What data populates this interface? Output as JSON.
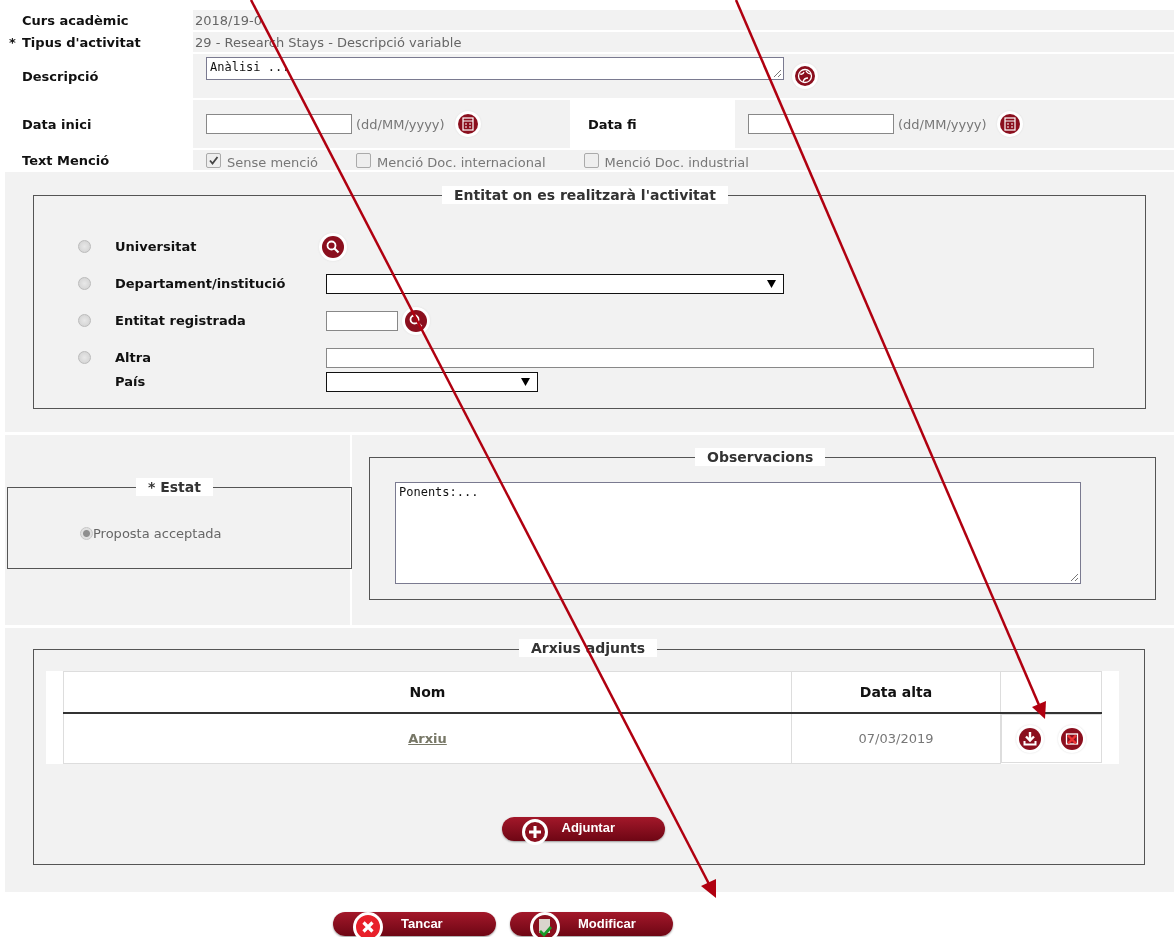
{
  "fields": [
    {
      "label": "Curs acadèmic",
      "value": "2018/19-0"
    },
    {
      "label": "Tipus d'activitat",
      "required_mark": "*",
      "value": "29 - Research Stays - Descripció variable"
    }
  ],
  "description": {
    "label": "Descripció",
    "value": "Anàlisi ..."
  },
  "dates": [
    {
      "label": "Data inici",
      "format": "(dd/MM/yyyy)"
    },
    {
      "label": "Data fi",
      "format": "(dd/MM/yyyy)"
    }
  ],
  "mention": {
    "label": "Text Menció",
    "options": [
      {
        "label": "Sense menció",
        "checked": true
      },
      {
        "label": "Menció Doc. internacional",
        "checked": false
      },
      {
        "label": "Menció Doc. industrial",
        "checked": false
      }
    ]
  },
  "entity": {
    "legend": "Entitat on es realitzarà l'activitat",
    "rows": [
      {
        "kind": "search",
        "label": "Universitat",
        "selected": false
      },
      {
        "kind": "select",
        "label": "Departament/institució",
        "selected": false
      },
      {
        "kind": "code",
        "label": "Entitat registrada",
        "selected": false
      },
      {
        "kind": "text",
        "label": "Altra",
        "selected": false
      },
      {
        "kind": "country",
        "label": "País"
      }
    ]
  },
  "status": {
    "legend": "* Estat",
    "option": {
      "label": "Proposta acceptada",
      "selected": true
    }
  },
  "observations": {
    "legend": "Observacions",
    "value": "Ponents:..."
  },
  "attachments": {
    "legend": "Arxius adjunts",
    "columns": [
      "Nom",
      "Data alta"
    ],
    "rows": [
      {
        "name": "Arxiu",
        "date": "07/03/2019"
      }
    ],
    "add_button": "Adjuntar"
  },
  "buttons": [
    {
      "kind": "close",
      "label": "Tancar"
    },
    {
      "kind": "modify",
      "label": "Modificar"
    }
  ]
}
